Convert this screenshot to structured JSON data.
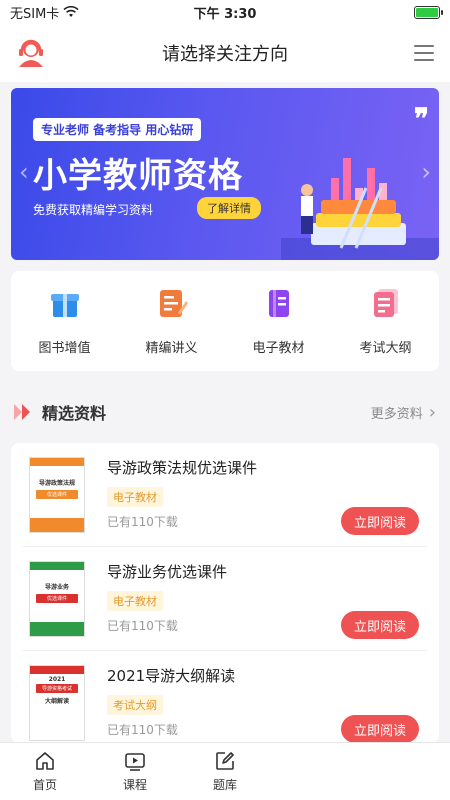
{
  "status": {
    "carrier": "无SIM卡",
    "time": "下午 3:30"
  },
  "header": {
    "title": "请选择关注方向"
  },
  "banner": {
    "tagline": "专业老师 备考指导 用心钻研",
    "title": "小学教师资格",
    "subtitle": "免费获取精编学习资料",
    "button": "了解详情",
    "accent": "#ffd43b"
  },
  "quick": [
    {
      "label": "图书增值",
      "icon": "gift-icon",
      "color": "#2d8de8"
    },
    {
      "label": "精编讲义",
      "icon": "handout-icon",
      "color": "#f07b3c"
    },
    {
      "label": "电子教材",
      "icon": "ebook-icon",
      "color": "#8e44ef"
    },
    {
      "label": "考试大纲",
      "icon": "syllabus-icon",
      "color": "#f26d8e"
    }
  ],
  "section": {
    "title": "精选资料",
    "more": "更多资料"
  },
  "items": [
    {
      "title": "导游政策法规优选课件",
      "tag": "电子教材",
      "downloads": "已有110下载",
      "action": "立即阅读",
      "cover": {
        "line1": "导游政策法规",
        "line2": "优选课件",
        "color": "#f08a2a"
      }
    },
    {
      "title": "导游业务优选课件",
      "tag": "电子教材",
      "downloads": "已有110下载",
      "action": "立即阅读",
      "cover": {
        "line1": "导游业务",
        "line2": "优选课件",
        "color": "#2e9b48"
      }
    },
    {
      "title": "2021导游大纲解读",
      "tag": "考试大纲",
      "downloads": "已有110下载",
      "action": "立即阅读",
      "cover": {
        "line1": "导游资格考试",
        "line2": "大纲解读",
        "year": "2021",
        "color": "#d9322e"
      }
    }
  ],
  "nav": [
    {
      "label": "首页",
      "icon": "home-icon"
    },
    {
      "label": "课程",
      "icon": "play-icon"
    },
    {
      "label": "题库",
      "icon": "edit-icon"
    }
  ],
  "colors": {
    "primary": "#ee5253",
    "banner": "#4a4fe8"
  }
}
